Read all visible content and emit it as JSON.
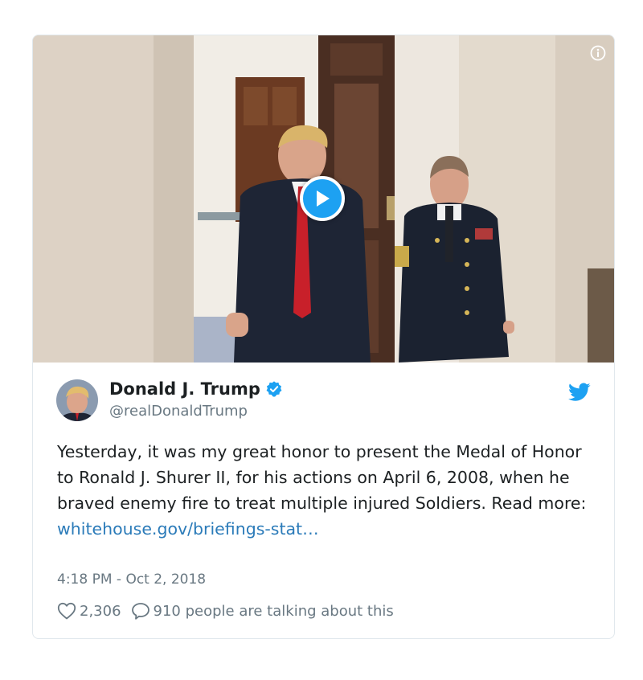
{
  "tweet": {
    "author": {
      "display_name": "Donald J. Trump",
      "handle": "@realDonaldTrump",
      "verified": true,
      "avatar_icon": "profile-photo"
    },
    "text_before_link": "Yesterday, it was my great honor to present the Medal of Honor to Ronald J. Shurer II, for his actions on April 6, 2008, when he braved enemy fire to treat multiple injured Soldiers. Read more: ",
    "link_text": "whitehouse.gov/briefings-stat…",
    "timestamp": "4:18 PM - Oct 2, 2018",
    "likes": "2,306",
    "replies_text": "910 people are talking about this"
  },
  "media": {
    "type": "video",
    "play_icon": "play-icon",
    "info_icon": "info-icon"
  },
  "icons": {
    "brand": "twitter-bird-icon",
    "like": "heart-icon",
    "reply": "speech-bubble-icon"
  },
  "colors": {
    "accent": "#1da1f2",
    "link": "#2b7bb9",
    "text": "#1c2022",
    "muted": "#697882",
    "border": "#e1e8ed"
  }
}
